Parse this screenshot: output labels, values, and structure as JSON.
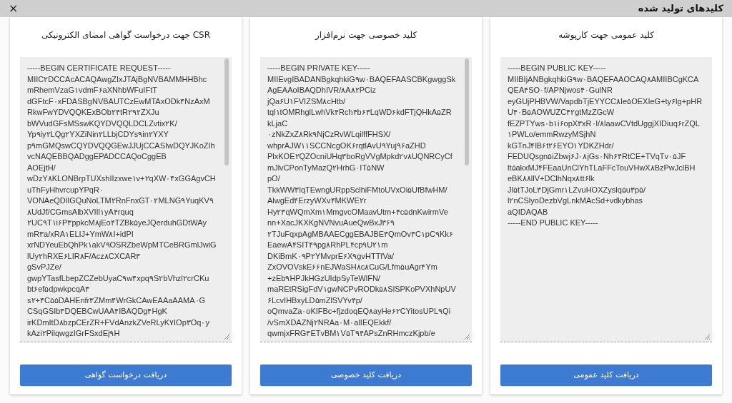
{
  "dialog": {
    "title": "کلیدهای تولید شده",
    "close": "×"
  },
  "panels": [
    {
      "title": "کلید عمومی جهت کارپوشه",
      "lines": [
        "-----BEGIN PUBLIC KEY-----",
        "MIIBIjANBgkqhkiG۹w۰BAQEFAAOCAQ۸AMIIBCgKCA",
        "QEA۴SO۰f/APNjwos۴۰GulNR",
        "eyGUjPHBVW/VapdbTjEYYCC۸Ie۵OEXIeG+ty۶lg+pHR",
        "U۴۰B۵AOWUZC۴۲gtMzZGcW",
        "fEZPTYws۰b۱i۶opX۳xR۰l/۸laawCVtdUggjXIDiuq۶rZQL",
        "۱PWLo/emmRwzyMSjhN",
        "kGTnJ۴lB۶t۲۶EYO۱YDKZHdr/",
        "FEDUQsgn۵iZbwj۶J۰۸jGs۰Nh۶۴RtCE+TVqTv۰۵JF",
        "lt۵akxMJ۴FEaaUnClYhTLaFFcTouVHwX۸BzPwJclBH",
        "eBK۸۸llV+DClhNqx۸tt۶lk",
        "Jl۵tTJoL۳DjGmr۱LZvuHOXZyslq۵u۳p۵/",
        "l۲nCSlyoDezbVgLnkMAcSd+vdkybhas",
        "aQIDAQAB",
        "-----END PUBLIC KEY-----"
      ],
      "button": "دریافت کلید عمومی"
    },
    {
      "title": "کلید خصوصی جهت نرم‌افزار",
      "lines": [
        "-----BEGIN PRIVATE KEY-----",
        "MIIEvgIBADANBgkqhkiG۹w۰BAQEFAASCBKgwggSk",
        "AgEAAoIBAQDhIVR/۸A۸۲PCiz",
        "jQa۶U۱FVIZSM۸cHtb/",
        "tql۱tOMRhglLwhVk۴Rch۴b۶۳LqWD۶kdFTjQHkA۵ZR",
        "kLjaC",
        "۰zNkZxZ۸Rk۹NjCzRvWLqilffFHSX/",
        "whprAJW۱۱SCCNcgOK۶rqtlAvU۹Yuj۹۶aZHD",
        "PlxKOE۲QZOcniUHq۳boRgVVgMpkd۲v۸UQNRCyCf",
        "mJlvCPonTyMazQ۲HrhG۰IT۵NW",
        "pO/",
        "TkkWW۳lqTEwngURppSclhiFMtoUVxOi۵UfBfwHM/",
        "AlwgEd۴ErzyWXv۴MKWE۲r",
        "Hy۲۳qWQmXm۱MmgvcOMaavUtm+۴c۵dnKwirmVe",
        "nn+XacJKXKgNVNvuAueQwBxJ۳۶۹",
        "۲TJuFqxpAgMBAAECggEBAJBE۳QmOv۳C۱pC۹Kk۶",
        "EaewA۴SIT۴۹pg۸RhPL۴cp۹U۲۱m",
        "DKiBmK۰۹P۲YMvprE۶X۹gvHTTfVa/",
        "ZxOVOVskE۶۶nEJWaSH۸c۸CuG/Lfm۵uAgr۴Ym",
        "+zEb۹HPJkHGzUIdpSyTeWlFN/",
        "maREtRSigFdV۱gwNCPvRODk۵۸SlSPKoPVXhNpUV",
        "۶LcvIHBxyLD۵mZlSVYv۴p/",
        "oQmvaZa۰oKIFBc+fjzdoqEQ۸ayHe۶۲CYitosUPL۹Qi",
        "/vSmXDAZNj۲NRAa۰M۰alIEQEkkf/",
        "qwmjxFRG۳ETvBM۱V۵T۹۴APsZnRHmczKjpb/e"
      ],
      "button": "دریافت کلید خصوصی"
    },
    {
      "title": "CSR جهت درخواست گواهی امضای الکترونیکی",
      "lines": [
        "-----BEGIN CERTIFICATE REQUEST-----",
        "MIIC۲DCCAcACAQAwgZIxJTAjBgNVBAMMHHBhc",
        "mRhemVzaG۱vdmF۶aXNhbWFuIFtT",
        "dGFtcF۰xFDASBgNVBAUTCzEwMTAxODk۴NzAxM",
        "RkwFwYDVQQKExBOb۲۴tR۲۹۲ZXJu",
        "bWVudGFsMSswKQYDVQQLDCLZvtix۲K/",
        "Yp۹iy۲LQg۲YXZiNin۲LLbjCDYs۹in۲YXY",
        "p۹mGMQswCQYDVQQGEwJJUjCCASIwDQYJKoZIh",
        "vcNAQEBBQADggEPADCCAQoCggEB",
        "AOEjtH/",
        "wDzY۸KLONBrpTUXshIIzxwe۱v+۲qXW۰۴xGGAgvCH",
        "uThFyHhvrcupYPqR۰",
        "VONAeQDlIGQuNoLTM۲RnFnxGT۰۲MLNG۹YuqKV۹",
        "۸UdJf/CGmsAlbXVIIl۱yA۴rquq",
        "۲UC۹T۱i۶P۳ppkcM۸jEo۴TZBk۵yeJQerduhGDtWAy",
        "mR۳a/xRA۱ELIJ+YmW۸I+idPI",
        "xrNDYeuEbQhPk۱akV۹OSRZbeWpMTCeBRGmlJwiG",
        "lUy۲hRXE۶LIR۸F/Acz۸CXCAR۳",
        "gSvPJZe/",
        "gwpYTasfLbepZCZebUyaC۹w۴xpq۹S۲bVhzl۲crCKu",
        "bt۶ef۵dpwkpcqA۳",
        "s۲+۴C۵۵DAHEnfr۳ZMm۴WrGkCAwEAAaAAMA۰G",
        "CSqGSIb۳DQEBCwUAA۴IBAQDg۴HgK",
        "irKDmItD۸bzpCErZR+FVdAnzkZVeRLyK۷IOp۳Oq۰y",
        "kAzi۲PilqwgzIGrFSxdEj۹H"
      ],
      "button": "دریافت درخواست گواهی"
    }
  ]
}
